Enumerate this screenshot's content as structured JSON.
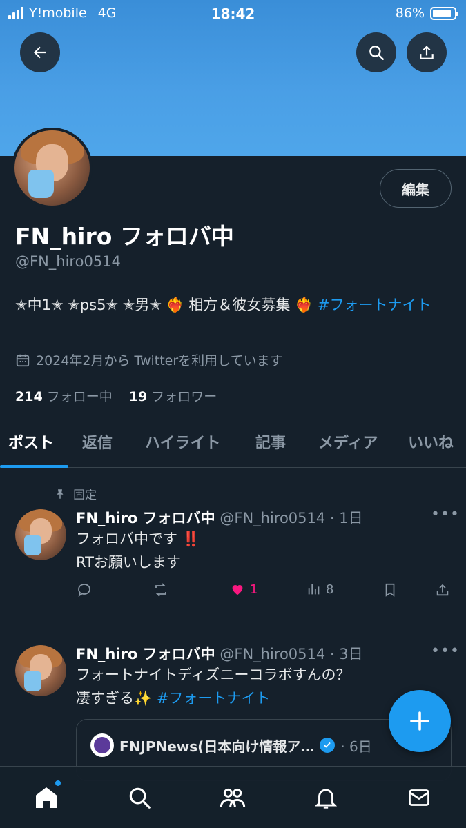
{
  "status_bar": {
    "carrier": "Y!mobile",
    "network": "4G",
    "time": "18:42",
    "battery": "86%",
    "battery_level": 0.86
  },
  "header": {
    "back_icon": "arrow-left-icon",
    "search_icon": "search-icon",
    "share_icon": "share-icon"
  },
  "profile": {
    "edit_label": "編集",
    "name": "FN_hiro フォロバ中",
    "handle": "@FN_hiro0514",
    "bio_text": "✭中1✭ ✭ps5✭ ✭男✭ ❤️‍🔥 相方＆彼女募集 ❤️‍🔥 ",
    "bio_hashtag": "#フォートナイト",
    "joined": "2024年2月から Twitterを利用しています",
    "following_count": "214",
    "following_label": "フォロー中",
    "followers_count": "19",
    "followers_label": "フォロワー"
  },
  "tabs": [
    {
      "label": "ポスト",
      "active": true
    },
    {
      "label": "返信"
    },
    {
      "label": "ハイライト"
    },
    {
      "label": "記事"
    },
    {
      "label": "メディア"
    },
    {
      "label": "いいね"
    }
  ],
  "posts": [
    {
      "pinned_label": "固定",
      "name": "FN_hiro フォロバ中",
      "meta": "@FN_hiro0514 · 1日",
      "line1": "フォロバ中です ‼️",
      "line2": "RTお願いします",
      "likes": "1",
      "views": "8"
    },
    {
      "name": "FN_hiro フォロバ中",
      "meta": "@FN_hiro0514 · 3日",
      "line1": "フォートナイトディズニーコラボすんの？",
      "line2_text": "凄すぎる✨ ",
      "line2_hashtag": "#フォートナイト",
      "quote": {
        "name": "FNJPNews(日本向け情報ア…",
        "meta": "· 6日"
      }
    }
  ],
  "colors": {
    "background": "#15202b",
    "accent": "#1d9bf0",
    "like": "#f91880",
    "muted": "#8b98a5"
  },
  "bottom_nav": [
    "home-icon",
    "search-icon",
    "communities-icon",
    "notifications-icon",
    "messages-icon"
  ]
}
